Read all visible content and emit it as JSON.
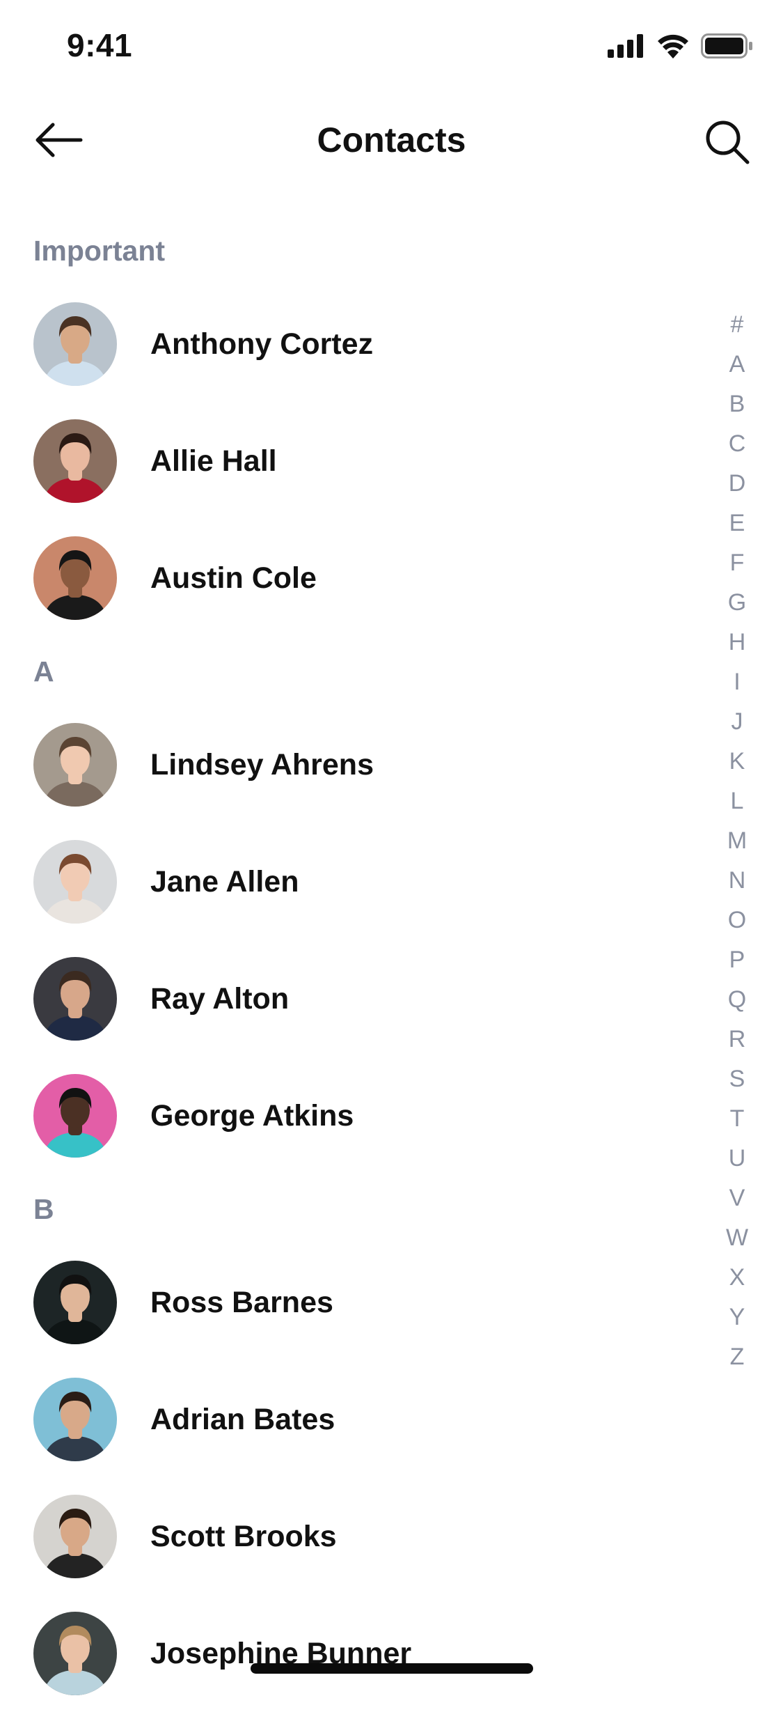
{
  "status_bar": {
    "time": "9:41",
    "icons": [
      "signal-icon",
      "wifi-icon",
      "battery-icon"
    ]
  },
  "nav": {
    "title": "Contacts",
    "back_icon": "arrow-left-icon",
    "search_icon": "search-icon"
  },
  "sections": [
    {
      "header": "Important",
      "contacts": [
        {
          "name": "Anthony Cortez",
          "avatar_bg": "#b9c3cc",
          "skin": "#d8a986",
          "hair": "#4a3223",
          "shirt": "#cfe0ee"
        },
        {
          "name": "Allie Hall",
          "avatar_bg": "#8a6f60",
          "skin": "#e9b9a0",
          "hair": "#2b1a14",
          "shirt": "#b0132b"
        },
        {
          "name": "Austin Cole",
          "avatar_bg": "#c9876b",
          "skin": "#8a5a3f",
          "hair": "#151515",
          "shirt": "#1a1a1a"
        }
      ]
    },
    {
      "header": "A",
      "contacts": [
        {
          "name": "Lindsey Ahrens",
          "avatar_bg": "#a49a8e",
          "skin": "#f0c9b0",
          "hair": "#5b4433",
          "shirt": "#7a6a5e"
        },
        {
          "name": "Jane Allen",
          "avatar_bg": "#d8dadc",
          "skin": "#f1cbb4",
          "hair": "#7a4a30",
          "shirt": "#e9e4df"
        },
        {
          "name": "Ray Alton",
          "avatar_bg": "#3a3a40",
          "skin": "#d7a78a",
          "hair": "#3b2a20",
          "shirt": "#1f2a44"
        },
        {
          "name": "George Atkins",
          "avatar_bg": "#e35ea7",
          "skin": "#4b3024",
          "hair": "#121212",
          "shirt": "#37c1c7"
        }
      ]
    },
    {
      "header": "B",
      "contacts": [
        {
          "name": "Ross Barnes",
          "avatar_bg": "#1d2526",
          "skin": "#e0b699",
          "hair": "#111111",
          "shirt": "#0f1515"
        },
        {
          "name": "Adrian Bates",
          "avatar_bg": "#7fbfd6",
          "skin": "#d8a989",
          "hair": "#2a1d16",
          "shirt": "#2f3b4a"
        },
        {
          "name": "Scott Brooks",
          "avatar_bg": "#d5d3cf",
          "skin": "#d8a887",
          "hair": "#2a1b12",
          "shirt": "#232323"
        },
        {
          "name": "Josephine Bunner",
          "avatar_bg": "#3d4444",
          "skin": "#eac1a6",
          "hair": "#b28b5e",
          "shirt": "#b9d3dd"
        }
      ]
    }
  ],
  "alphabet_index": [
    "#",
    "A",
    "B",
    "C",
    "D",
    "E",
    "F",
    "G",
    "H",
    "I",
    "J",
    "K",
    "L",
    "M",
    "N",
    "O",
    "P",
    "Q",
    "R",
    "S",
    "T",
    "U",
    "V",
    "W",
    "X",
    "Y",
    "Z"
  ]
}
